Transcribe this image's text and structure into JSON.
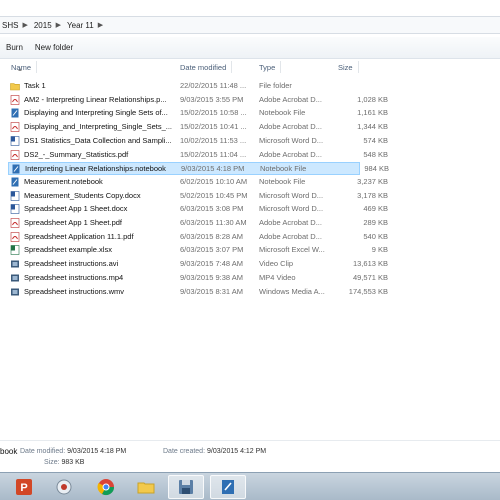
{
  "address": {
    "crumbs": [
      "SHS",
      "2015",
      "Year 11"
    ]
  },
  "toolbar": {
    "burn_label": "Burn",
    "new_folder_label": "New folder"
  },
  "columns": {
    "name": "Name",
    "date": "Date modified",
    "type": "Type",
    "size": "Size"
  },
  "files": [
    {
      "name": "Task 1",
      "date": "22/02/2015 11:48 ...",
      "type": "File folder",
      "size": "",
      "icon": "folder-icon"
    },
    {
      "name": "AM2 - Interpreting Linear Relationships.p...",
      "date": "9/03/2015 3:55 PM",
      "type": "Adobe Acrobat D...",
      "size": "1,028 KB",
      "icon": "pdf-icon"
    },
    {
      "name": "Displaying and Interpreting Single Sets of...",
      "date": "15/02/2015 10:58 ...",
      "type": "Notebook File",
      "size": "1,161 KB",
      "icon": "notebook-icon"
    },
    {
      "name": "Displaying_and_Interpreting_Single_Sets_...",
      "date": "15/02/2015 10:41 ...",
      "type": "Adobe Acrobat D...",
      "size": "1,344 KB",
      "icon": "pdf-icon"
    },
    {
      "name": "DS1 Statistics_Data Collection and Sampli...",
      "date": "10/02/2015 11:53 ...",
      "type": "Microsoft Word D...",
      "size": "574 KB",
      "icon": "word-icon"
    },
    {
      "name": "DS2_-_Summary_Statistics.pdf",
      "date": "15/02/2015 11:04 ...",
      "type": "Adobe Acrobat D...",
      "size": "548 KB",
      "icon": "pdf-icon"
    },
    {
      "name": "Interpreting Linear Relationships.notebook",
      "date": "9/03/2015 4:18 PM",
      "type": "Notebook File",
      "size": "984 KB",
      "icon": "notebook-icon",
      "selected": true
    },
    {
      "name": "Measurement.notebook",
      "date": "6/02/2015 10:10 AM",
      "type": "Notebook File",
      "size": "3,237 KB",
      "icon": "notebook-icon"
    },
    {
      "name": "Measurement_Students Copy.docx",
      "date": "5/02/2015 10:45 PM",
      "type": "Microsoft Word D...",
      "size": "3,178 KB",
      "icon": "word-icon"
    },
    {
      "name": "Spreadsheet App 1 Sheet.docx",
      "date": "6/03/2015 3:08 PM",
      "type": "Microsoft Word D...",
      "size": "469 KB",
      "icon": "word-icon"
    },
    {
      "name": "Spreadsheet App 1 Sheet.pdf",
      "date": "6/03/2015 11:30 AM",
      "type": "Adobe Acrobat D...",
      "size": "289 KB",
      "icon": "pdf-icon"
    },
    {
      "name": "Spreadsheet Application 11.1.pdf",
      "date": "6/03/2015 8:28 AM",
      "type": "Adobe Acrobat D...",
      "size": "540 KB",
      "icon": "pdf-icon"
    },
    {
      "name": "Spreadsheet example.xlsx",
      "date": "6/03/2015 3:07 PM",
      "type": "Microsoft Excel W...",
      "size": "9 KB",
      "icon": "excel-icon"
    },
    {
      "name": "Spreadsheet instructions.avi",
      "date": "9/03/2015 7:48 AM",
      "type": "Video Clip",
      "size": "13,613 KB",
      "icon": "video-icon"
    },
    {
      "name": "Spreadsheet instructions.mp4",
      "date": "9/03/2015 9:38 AM",
      "type": "MP4 Video",
      "size": "49,571 KB",
      "icon": "video-icon"
    },
    {
      "name": "Spreadsheet instructions.wmv",
      "date": "9/03/2015 8:31 AM",
      "type": "Windows Media A...",
      "size": "174,553 KB",
      "icon": "video-icon"
    }
  ],
  "details": {
    "filename": "book",
    "modified_label": "Date modified:",
    "modified": "9/03/2015 4:18 PM",
    "created_label": "Date created:",
    "created": "9/03/2015 4:12 PM",
    "size_label": "Size:",
    "size": "983 KB"
  },
  "taskbar": {
    "apps": [
      "powerpoint-icon",
      "media-icon",
      "chrome-icon",
      "folder-icon",
      "explorer-icon",
      "notebook-icon"
    ]
  }
}
